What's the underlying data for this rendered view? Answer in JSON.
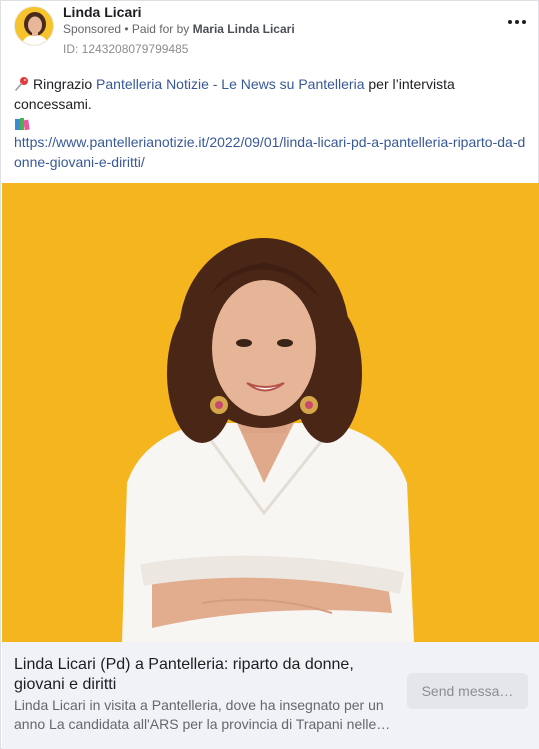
{
  "header": {
    "page_name": "Linda Licari",
    "sponsored": "Sponsored",
    "paid_for_by": " • Paid for by ",
    "payer": "Maria Linda Licari",
    "ad_id": "ID: 1243208079799485",
    "more_icon": "more-options-icon"
  },
  "post": {
    "pin_icon": "pushpin-icon",
    "text_before": "Ringrazio ",
    "linked_page": "Pantelleria Notizie - Le News su Pantelleria",
    "text_after": " per l’intervista concessami.",
    "books_icon": "books-icon",
    "url": "https://www.pantellerianotizie.it/2022/09/01/linda-licari-pd-a-pantelleria-riparto-da-donne-giovani-e-diritti/"
  },
  "link_preview": {
    "title": "Linda Licari (Pd) a Pantelleria: riparto da donne, giovani e diritti",
    "description": "Linda Licari in visita a Pantelleria, dove ha insegnato per un anno La candidata all'ARS per la provincia di Trapani nelle…",
    "send_button": "Send messa…"
  },
  "colors": {
    "brand_link": "#385898",
    "hero_background": "#f5b51e",
    "caption_background": "#f0f2f5"
  }
}
